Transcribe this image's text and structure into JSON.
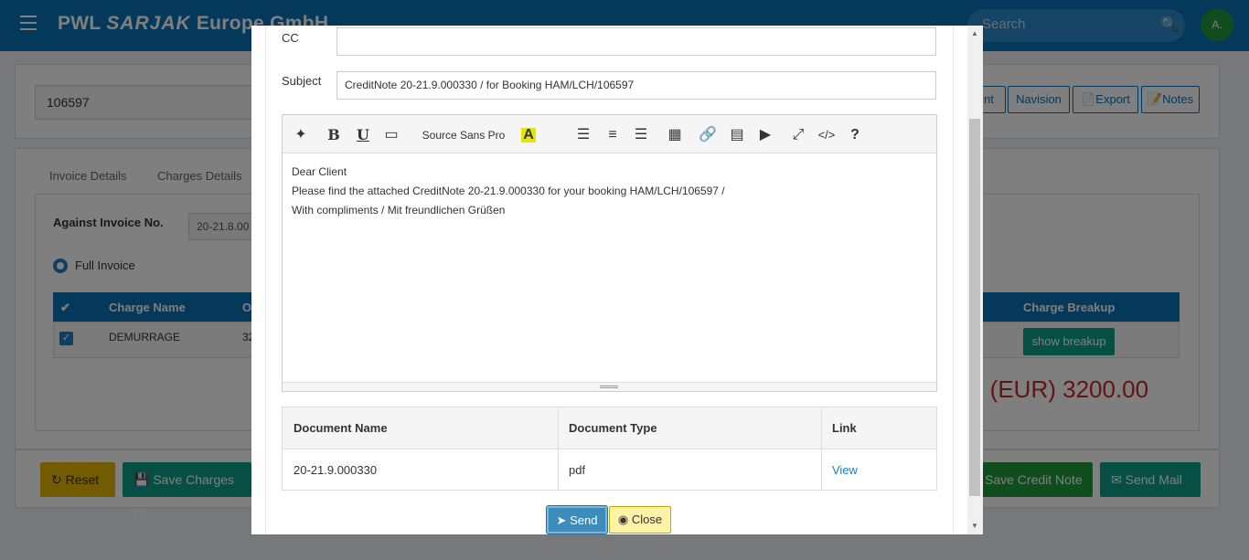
{
  "app": {
    "brand_prefix": "PWL",
    "brand_logo": "SARJAK",
    "brand_suffix": "Europe GmbH",
    "search_placeholder": "Search",
    "avatar_initial": "A."
  },
  "background": {
    "booking_no": "106597",
    "toolbar_buttons": [
      "int",
      "Navision",
      "Export",
      "Notes"
    ],
    "tabs": [
      "Invoice Details",
      "Charges Details"
    ],
    "against_invoice_label": "Against Invoice No.",
    "against_invoice_value": "20-21.8.00",
    "full_invoice_label": "Full Invoice",
    "table_headers": [
      "Charge Name",
      "O",
      "Charge Breakup"
    ],
    "row": {
      "charge": "DEMURRAGE",
      "col2": "32"
    },
    "show_breakup": "show breakup",
    "total": "tal (EUR) 3200.00",
    "footer_buttons": {
      "reset": "Reset",
      "save_charges": "Save Charges Or",
      "save_credit_note": "Save Credit Note",
      "send_mail": "Send Mail"
    }
  },
  "modal": {
    "cc_label": "CC",
    "cc_value": "",
    "subject_label": "Subject",
    "subject_value": "CreditNote 20-21.9.000330 / for Booking HAM/LCH/106597",
    "toolbar": {
      "font_name": "Source Sans Pro"
    },
    "body_lines": [
      "Dear Client",
      "Please find the attached CreditNote 20-21.9.000330 for your booking HAM/LCH/106597 /",
      "With compliments / Mit freundlichen Grüßen"
    ],
    "documents": {
      "headers": [
        "Document Name",
        "Document Type",
        "Link"
      ],
      "rows": [
        {
          "name": "20-21.9.000330",
          "type": "pdf",
          "link": "View"
        }
      ]
    },
    "send_label": "Send",
    "close_label": "Close"
  },
  "colors": {
    "primary": "#0b72b8",
    "success": "#1e9a3c",
    "teal": "#0e9d8a",
    "warning": "#e5b700",
    "danger_text": "#c62828"
  }
}
